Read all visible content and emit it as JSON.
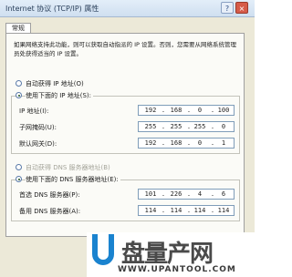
{
  "window": {
    "title": "Internet 协议 (TCP/IP) 属性",
    "help_label": "?",
    "close_label": "×"
  },
  "tabs": [
    {
      "label": "常规"
    }
  ],
  "description": "如果网络支持此功能，则可以获取自动指派的 IP 设置。否则，您需要从网络系统管理员处获得适当的 IP 设置。",
  "ip_section": {
    "auto_label": "自动获得 IP 地址(O)",
    "manual_label": "使用下面的 IP 地址(S):",
    "selected": "manual",
    "fields": [
      {
        "label": "IP 地址(I):",
        "octets": [
          "192",
          "168",
          "0",
          "100"
        ]
      },
      {
        "label": "子网掩码(U):",
        "octets": [
          "255",
          "255",
          "255",
          "0"
        ]
      },
      {
        "label": "默认网关(D):",
        "octets": [
          "192",
          "168",
          "0",
          "1"
        ]
      }
    ]
  },
  "dns_section": {
    "auto_label": "自动获得 DNS 服务器地址(B)",
    "manual_label": "使用下面的 DNS 服务器地址(E):",
    "selected": "manual",
    "fields": [
      {
        "label": "首选 DNS 服务器(P):",
        "octets": [
          "101",
          "226",
          "4",
          "6"
        ]
      },
      {
        "label": "备用 DNS 服务器(A):",
        "octets": [
          "114",
          "114",
          "114",
          "114"
        ]
      }
    ]
  },
  "watermark": {
    "logo_letter": "U",
    "brand_text": "盘量产网",
    "url_text": "WWW.UPANTOOL.COM"
  },
  "colors": {
    "window_bg": "#ece9d8",
    "titlebar": "#cfdff0",
    "close_button": "#d65c49",
    "watermark_blue": "#1a83cf"
  }
}
